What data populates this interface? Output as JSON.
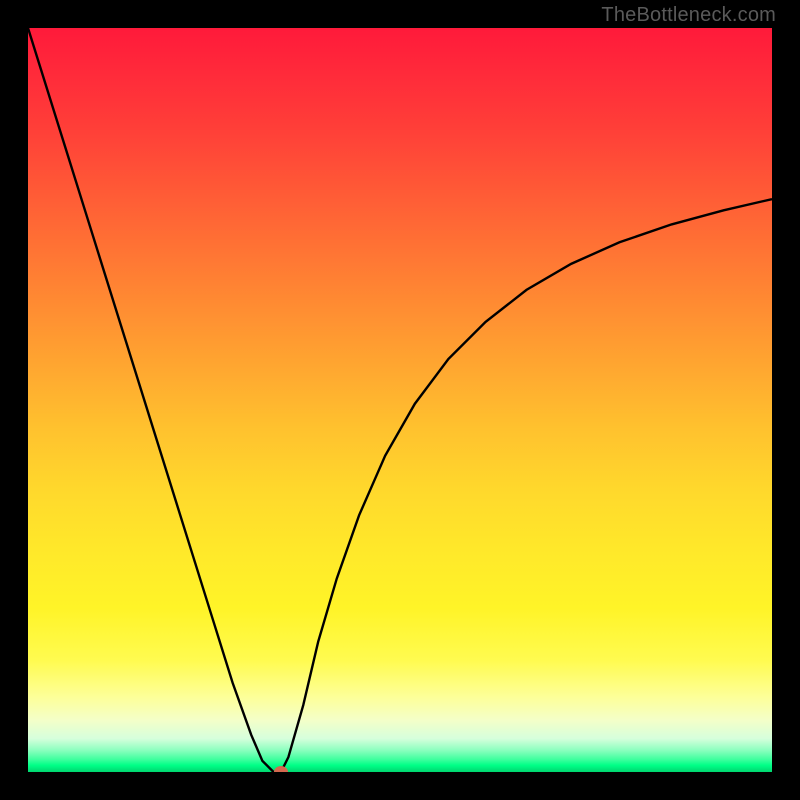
{
  "attribution": "TheBottleneck.com",
  "colors": {
    "frame": "#000000",
    "curve_stroke": "#000000",
    "marker": "#d4684f",
    "attribution_text": "#5a5a5a"
  },
  "chart_data": {
    "type": "line",
    "title": "",
    "xlabel": "",
    "ylabel": "",
    "xlim": [
      0,
      100
    ],
    "ylim": [
      0,
      100
    ],
    "grid": false,
    "legend": false,
    "background_gradient": {
      "direction": "vertical",
      "stops": [
        {
          "pos": 0.0,
          "label": "top",
          "meaning": "worst",
          "color": "#ff1a3a"
        },
        {
          "pos": 0.5,
          "label": "mid",
          "meaning": "medium",
          "color": "#ffc22e"
        },
        {
          "pos": 1.0,
          "label": "bottom",
          "meaning": "best",
          "color": "#00d86f"
        }
      ]
    },
    "series": [
      {
        "name": "bottleneck-curve",
        "x": [
          0.0,
          2.5,
          5.0,
          7.5,
          10.0,
          12.5,
          15.0,
          17.5,
          20.0,
          22.5,
          25.0,
          27.5,
          30.0,
          31.5,
          33.0,
          34.0,
          35.0,
          37.0,
          39.0,
          41.5,
          44.5,
          48.0,
          52.0,
          56.5,
          61.5,
          67.0,
          73.0,
          79.5,
          86.5,
          93.5,
          100.0
        ],
        "y": [
          100.0,
          92.0,
          84.0,
          76.0,
          68.0,
          60.0,
          52.0,
          44.0,
          36.0,
          28.0,
          20.0,
          12.0,
          5.0,
          1.5,
          0.0,
          0.0,
          2.0,
          9.0,
          17.5,
          26.0,
          34.5,
          42.5,
          49.5,
          55.5,
          60.5,
          64.8,
          68.3,
          71.2,
          73.6,
          75.5,
          77.0
        ]
      }
    ],
    "marker": {
      "x": 34.0,
      "y": 0.0,
      "name": "optimal-point"
    }
  }
}
